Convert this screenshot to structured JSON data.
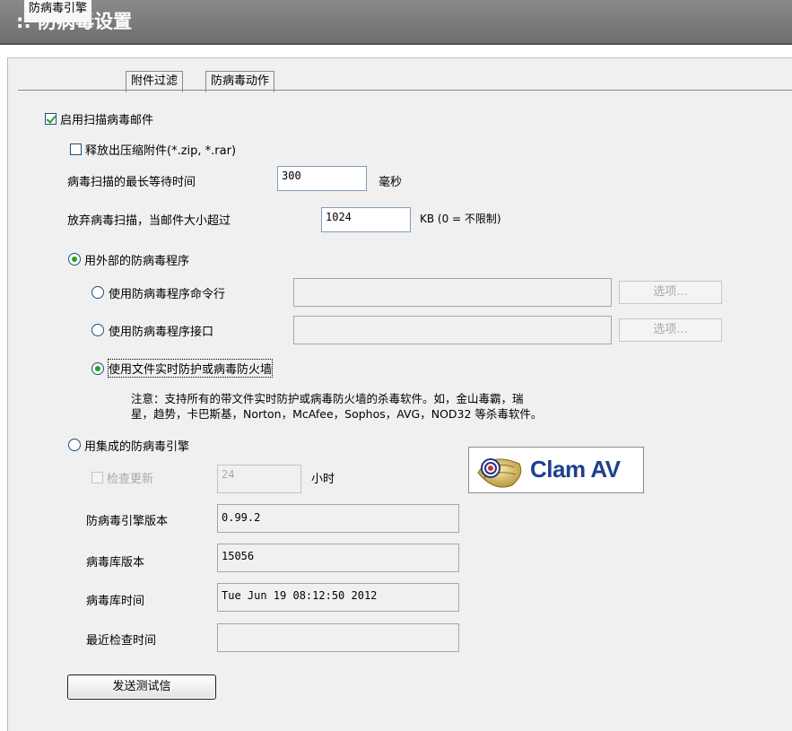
{
  "title": ":: 防病毒设置",
  "tabs": [
    {
      "label": "防病毒引擎",
      "active": true
    },
    {
      "label": "附件过滤",
      "active": false
    },
    {
      "label": "防病毒动作",
      "active": false
    }
  ],
  "scan": {
    "enable_label": "启用扫描病毒邮件",
    "enable_checked": true,
    "unzip_label": "释放出压缩附件(*.zip, *.rar)",
    "unzip_checked": false,
    "maxwait_label": "病毒扫描的最长等待时间",
    "maxwait_value": "300",
    "maxwait_unit": "毫秒",
    "skip_label": "放弃病毒扫描，当邮件大小超过",
    "skip_value": "1024",
    "skip_unit": "KB  (0 = 不限制)"
  },
  "external": {
    "label": "用外部的防病毒程序",
    "selected": true,
    "cmdline_label": "使用防病毒程序命令行",
    "cmdline_value": "",
    "interface_label": "使用防病毒程序接口",
    "interface_value": "",
    "options_label": "选项...",
    "realtime_label": "使用文件实时防护或病毒防火墙",
    "realtime_selected": true,
    "note_line1": "注意：支持所有的带文件实时防护或病毒防火墙的杀毒软件。如，金山毒霸，瑞",
    "note_line2": "星，趋势，卡巴斯基，Norton，McAfee，Sophos，AVG，NOD32 等杀毒软件。"
  },
  "integrated": {
    "label": "用集成的防病毒引擎",
    "selected": false,
    "update_label": "检查更新",
    "update_checked": false,
    "update_value": "24",
    "update_unit": "小时",
    "logo_text": "Clam AV",
    "engine_version_label": "防病毒引擎版本",
    "engine_version_value": "0.99.2",
    "db_version_label": "病毒库版本",
    "db_version_value": "15056",
    "db_time_label": "病毒库时间",
    "db_time_value": "Tue Jun 19 08:12:50 2012",
    "last_check_label": "最近检查时间",
    "last_check_value": ""
  },
  "send_test_label": "发送测试信"
}
